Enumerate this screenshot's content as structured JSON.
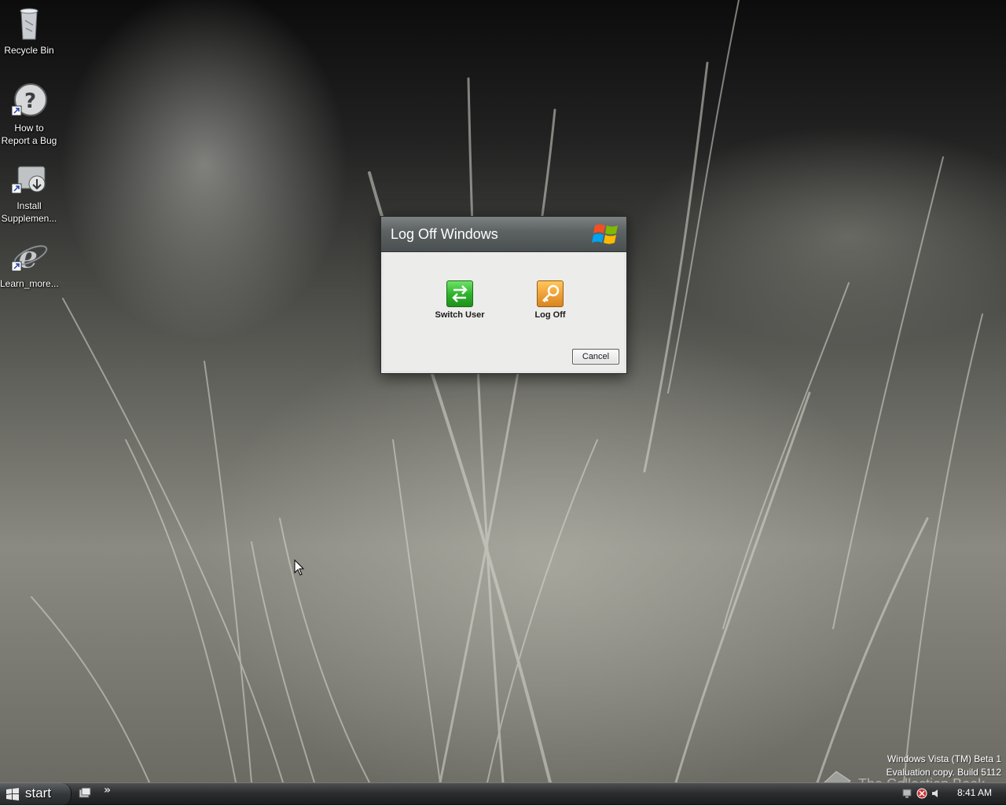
{
  "desktop": {
    "icons": [
      {
        "label": "Recycle Bin",
        "icon": "recycle-bin-icon"
      },
      {
        "label": "How to Report a Bug",
        "icon": "help-icon"
      },
      {
        "label": "Install Supplemen...",
        "icon": "install-icon"
      },
      {
        "label": "Learn_more...",
        "icon": "internet-explorer-icon"
      }
    ]
  },
  "dialog": {
    "title": "Log Off Windows",
    "options": [
      {
        "label": "Switch User",
        "icon": "switch-user-icon"
      },
      {
        "label": "Log Off",
        "icon": "key-icon"
      }
    ],
    "cancel_label": "Cancel"
  },
  "watermark": {
    "line1": "Windows Vista (TM) Beta 1",
    "line2": "Evaluation copy. Build 5112",
    "logo_text": "The Collection Book"
  },
  "taskbar": {
    "start_label": "start",
    "quicklaunch_chevron": "»",
    "clock": "8:41 AM"
  },
  "colors": {
    "dialog_header": "#5e6364",
    "dialog_body": "#ececea",
    "switch_green": "#2fb52b",
    "logoff_orange": "#f0a23a",
    "taskbar": "#2b2d2e"
  }
}
